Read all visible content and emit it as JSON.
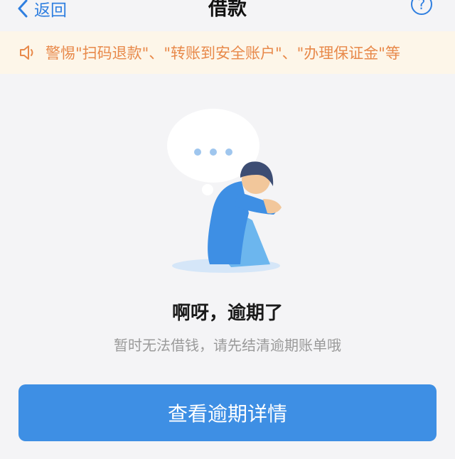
{
  "nav": {
    "back_label": "返回",
    "title": "借款",
    "help_label": "?"
  },
  "notice": {
    "icon": "speaker-icon",
    "text": "警惕\"扫码退款\"、\"转账到安全账户\"、\"办理保证金\"等"
  },
  "empty_state": {
    "illustration": "sad-person-with-speech-bubble",
    "headline": "啊呀，逾期了",
    "subtext": "暂时无法借钱，请先结清逾期账单哦"
  },
  "primary_button": {
    "label": "查看逾期详情"
  },
  "colors": {
    "accent": "#3e8fe4",
    "notice_bg": "#fdf6e9",
    "notice_text": "#e8894a",
    "page_bg": "#f4f4f6"
  }
}
